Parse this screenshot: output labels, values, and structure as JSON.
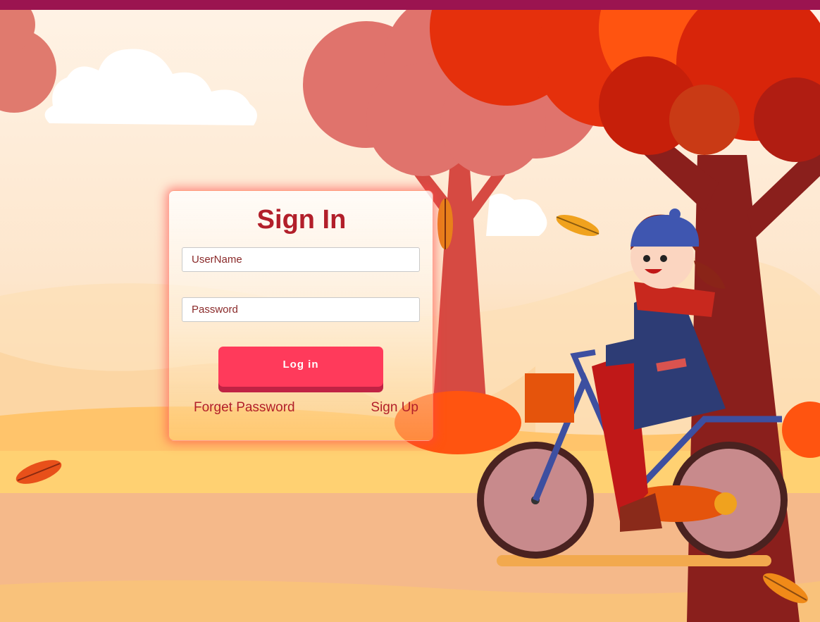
{
  "header": {
    "bar_color": "#9b1450"
  },
  "login_form": {
    "title": "Sign In",
    "username_placeholder": "UserName",
    "password_placeholder": "Password",
    "login_button": "Log in",
    "forget_password_link": "Forget Password",
    "sign_up_link": "Sign Up"
  },
  "colors": {
    "accent": "#ff3a5b",
    "title": "#b21f2a",
    "link": "#b21f2a"
  },
  "background_icons": [
    "autumn-tree-icon",
    "cyclist-girl-icon",
    "bicycle-icon",
    "falling-leaf-icon",
    "cloud-icon"
  ]
}
